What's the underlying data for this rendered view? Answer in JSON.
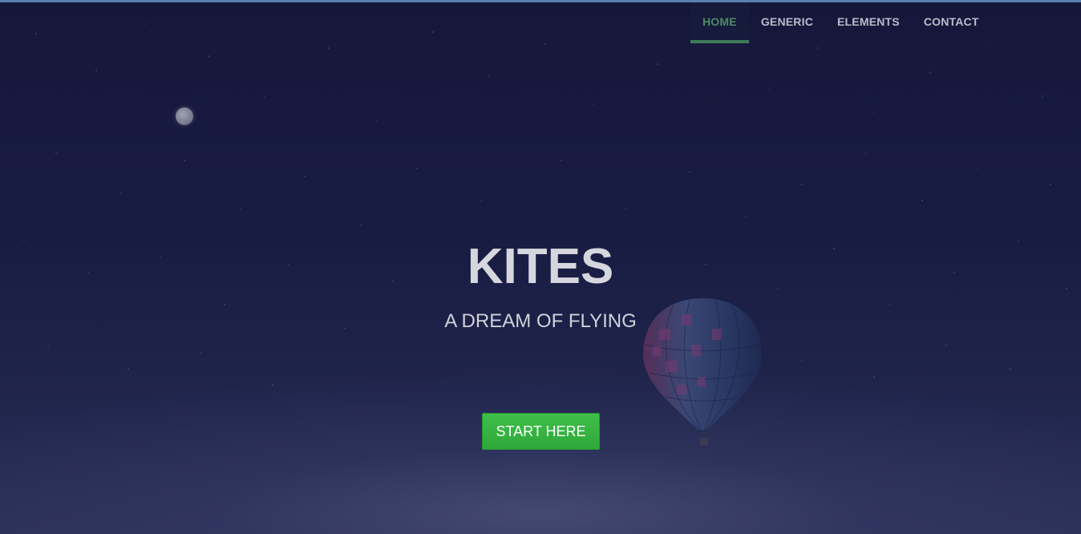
{
  "nav": {
    "items": [
      {
        "label": "HOME",
        "active": true
      },
      {
        "label": "GENERIC",
        "active": false
      },
      {
        "label": "ELEMENTS",
        "active": false
      },
      {
        "label": "CONTACT",
        "active": false
      }
    ]
  },
  "hero": {
    "title": "KITES",
    "subtitle": "A DREAM OF FLYING",
    "cta_label": "START HERE"
  },
  "colors": {
    "background": "#151835",
    "nav_active": "#4c8a63",
    "nav_underline": "#3f7a5a",
    "cta_green": "#3fbf4a",
    "top_accent": "#5a7fae"
  },
  "icons": {
    "moon": "moon-icon",
    "balloon": "hot-air-balloon-icon"
  }
}
